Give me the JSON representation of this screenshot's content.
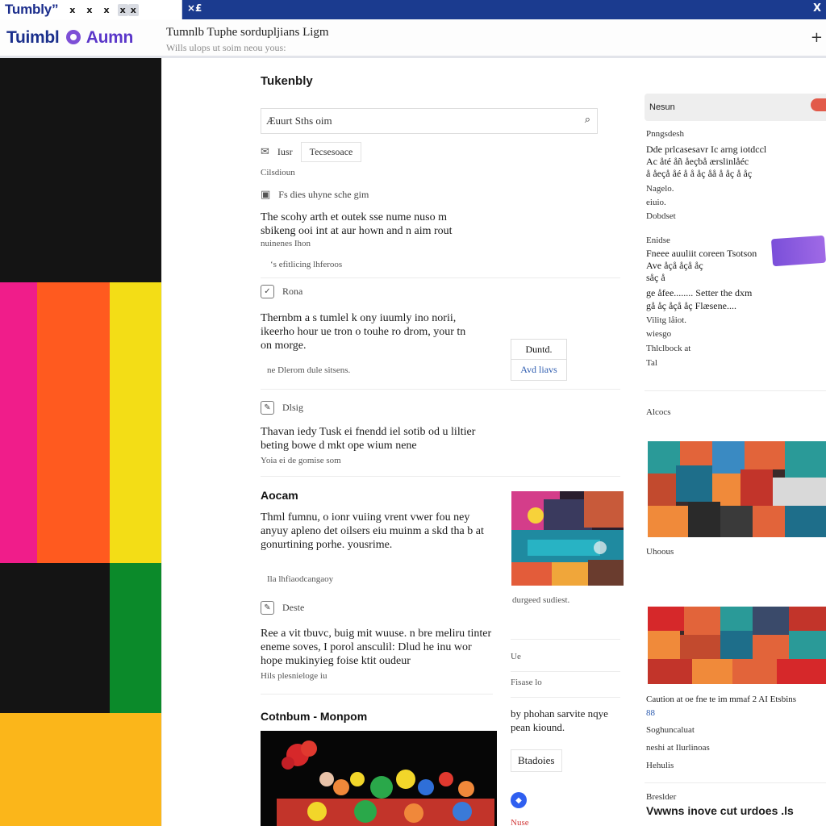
{
  "tabs": {
    "active_title": "Tumbly”",
    "close_glyphs": [
      "x",
      "x",
      "x"
    ],
    "second_tab": "×£",
    "window_close": "X"
  },
  "header": {
    "brand": "Tuimbl",
    "brand_suffix": "Aumn",
    "title": "Tumnlb Tuphe sordupljians Ligm",
    "subtitle": "Wills ulops ut soim neou yous:",
    "plus": "+"
  },
  "sidebar": {
    "colors": {
      "black": "#141414",
      "magenta": "#f01d8a",
      "orange": "#ff5a1f",
      "yellow": "#f3dd16",
      "green": "#0b8a2a",
      "amber": "#fbb61a"
    }
  },
  "feed": {
    "title": "Tukenbly",
    "search_value": "Æuurt Sths oim",
    "search_icon": "search-icon",
    "chip_icon_label": "Iusr",
    "chip_label": "Tecsesoace",
    "section_meta": "Cilsdioun",
    "post1": {
      "meta": "Fs dies uhyne sche gim",
      "text": "The scohy arth et outek sse nume nuso m sbikeng ooi int at aur hown and n aim rout",
      "text2": "nuinenes Ihon",
      "foot": "‘s  efitlicing lhferoos"
    },
    "post2": {
      "head": "Rona",
      "text": "Thernbm a s tumlel k ony iuumly ino norii, ikeerho hour ue tron o touhe ro drom, your tn on morge.",
      "foot": "ne Dlerom dule sitsens.",
      "btn1": "Duntd.",
      "btn2": "Avd liavs"
    },
    "post3": {
      "head": "Dlsig",
      "text": "Thavan iedy Tusk ei fnendd iel sotib od u liltier beting bowe d mkt ope wium nene",
      "foot": "Yoia ei de gomise som"
    },
    "section2_title": "Aocam",
    "post4": {
      "text": "Thml fumnu, o ionr vuiing vrent vwer fou ney anyuy apleno det oilsers eiu muinm a skd tha b at gonurtining porhe. yousrime.",
      "foot": "Ila lhfiaodcangaoy"
    },
    "post4_caption": "durgeed sudiest.",
    "post5": {
      "head": "Deste",
      "text": "Ree a vit tbuvc, buig mit wuuse. n bre meliru tinter eneme soves, I porol ansculil: Dlud he inu wor hope mukinyieg foise ktit oudeur",
      "foot": "Hils plesnieloge iu"
    },
    "mid_right_label1": "Ue",
    "mid_right_label2": "Fisase lo",
    "mid_right_text": "by phohan sarvite nqye pean kiound.",
    "bottom_btn": "Btadoies",
    "section3_title": "Cotnbum - Monpom",
    "red_link": "Nuse"
  },
  "right": {
    "news_label": "Nesun",
    "block1": {
      "label": "Pnngsdesh",
      "line1": "Dde prlcasesavr Ic arng iotdccl",
      "line2": "Ac åté åñ åeçbå ærslinlåéc",
      "line3": "å åeçå åé å å åç åå å åç å åç",
      "meta1": "Nagelo.",
      "meta2": "eiuio.",
      "meta3": "Dobdset"
    },
    "block2": {
      "label": "Enidse",
      "line1": "Fneee auuliit coreen Tsotson",
      "line2": "Ave åçå åçå åç",
      "line3": "såç å",
      "line4": "ge åfee........ Setter the dxm",
      "line5": "gå åç åçå åç Flæsene....",
      "meta1": "Vilitg låiot.",
      "meta2": "wiesgo",
      "meta3": "Thlclbock at",
      "meta4": "Tal"
    },
    "label_images": "Alcocs",
    "caption1": "Uhoous",
    "caption2": "Caution at oe fne te im mmaf 2 AI Etsbins",
    "caption2_meta": "88",
    "caption2_a": "Soghuncaluat",
    "caption2_b": "neshi at Ilurlinoas",
    "caption2_c": "Hehulis",
    "bottom_label": "Breslder",
    "bottom_text": "Vwwns inove cut urdoes .ls"
  }
}
